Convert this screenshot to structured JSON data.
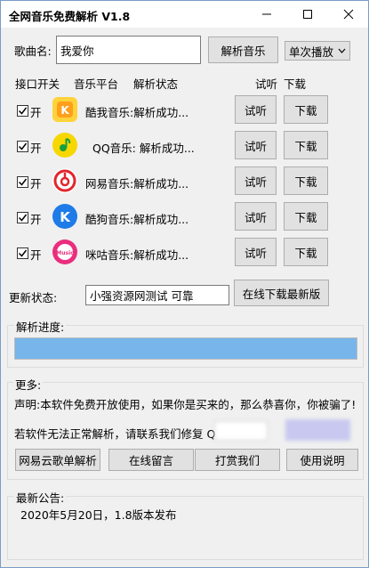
{
  "window": {
    "title": "全网音乐免费解析 V1.8"
  },
  "search": {
    "label": "歌曲名:",
    "value": "我爱你",
    "parse_button": "解析音乐",
    "play_mode": "单次播放"
  },
  "headers": {
    "toggle": "接口开关",
    "platform": "音乐平台",
    "status": "解析状态",
    "listen": "试听",
    "download": "下载"
  },
  "rows": [
    {
      "on": "开",
      "text": "酷我音乐:解析成功...",
      "listen": "试听",
      "download": "下载",
      "color": "#f5a623"
    },
    {
      "on": "开",
      "text": "QQ音乐: 解析成功...",
      "listen": "试听",
      "download": "下载",
      "color": "#f7c600"
    },
    {
      "on": "开",
      "text": "网易音乐:解析成功...",
      "listen": "试听",
      "download": "下载",
      "color": "#e3252c"
    },
    {
      "on": "开",
      "text": "酷狗音乐:解析成功...",
      "listen": "试听",
      "download": "下载",
      "color": "#1e7be8"
    },
    {
      "on": "开",
      "text": "咪咕音乐:解析成功...",
      "listen": "试听",
      "download": "下载",
      "color": "#ea2e7d"
    }
  ],
  "update": {
    "label": "更新状态:",
    "value": "小强资源网测试 可靠",
    "button": "在线下载最新版"
  },
  "progress": {
    "title": "解析进度:",
    "value": 1.0
  },
  "more": {
    "title": "更多:",
    "statement": "声明:本软件免费开放使用，如果你是买来的，那么恭喜你，你被骗了!",
    "contact": "若软件无法正常解析，请联系我们修复 Q",
    "buttons": [
      "网易云歌单解析",
      "在线留言",
      "打赏我们",
      "使用说明"
    ]
  },
  "announce": {
    "title": "最新公告:",
    "text": "2020年5月20日，1.8版本发布"
  }
}
